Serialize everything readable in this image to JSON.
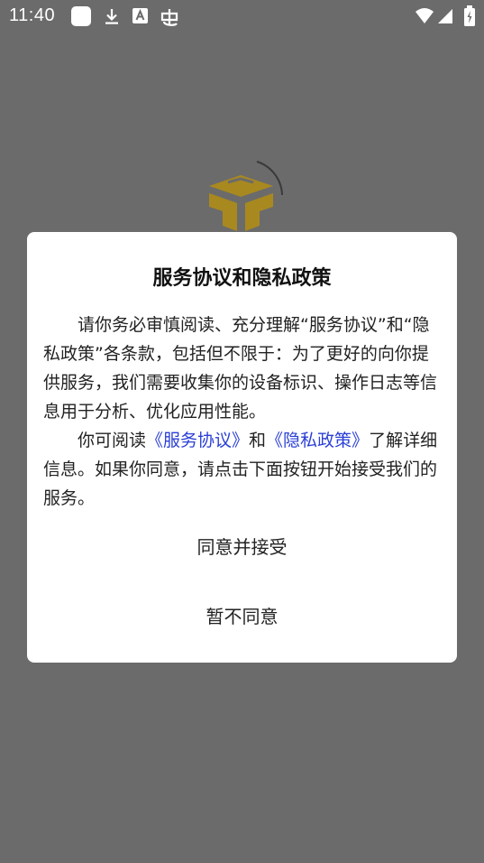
{
  "status_bar": {
    "time": "11:40",
    "icons": [
      "square-icon",
      "download-icon",
      "a-icon",
      "bug-icon",
      "wifi-icon",
      "signal-icon",
      "battery-icon"
    ],
    "color": "#ffffff"
  },
  "background": {
    "overlay_color": "#6b6b6b",
    "logo": "app-logo-icon",
    "logo_color": "#a8891f"
  },
  "dialog": {
    "title": "服务协议和隐私政策",
    "paragraph1": "请你务必审慎阅读、充分理解“服务协议”和“隐私政策”各条款，包括但不限于：为了更好的向你提供服务，我们需要收集你的设备标识、操作日志等信息用于分析、优化应用性能。",
    "paragraph2_prefix": "你可阅读",
    "link_service": "《服务协议》",
    "paragraph2_and": "和",
    "link_privacy": "《隐私政策》",
    "paragraph2_suffix": "了解详细信息。如果你同意，请点击下面按钮开始接受我们的服务。",
    "link_color": "#2a3fd6",
    "agree_button": "同意并接受",
    "decline_button": "暂不同意"
  }
}
